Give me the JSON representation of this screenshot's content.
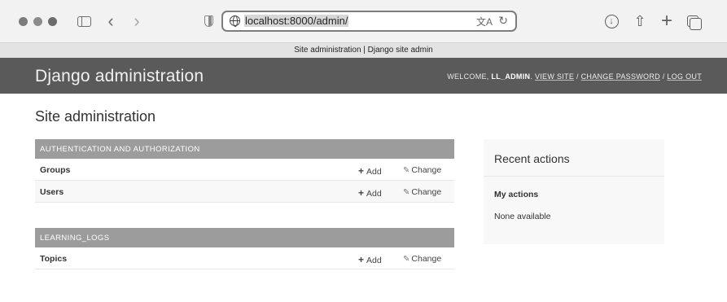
{
  "browser": {
    "url_prefix": "",
    "url": "localhost:8000/admin/",
    "tab_title": "Site administration | Django site admin",
    "back_glyph": "‹",
    "forward_glyph": "›",
    "translate_glyph": "文A",
    "reload_glyph": "↻",
    "download_glyph": "↓",
    "share_glyph": "⇧",
    "new_tab_glyph": "+"
  },
  "header": {
    "branding": "Django administration",
    "welcome": "WELCOME,",
    "username": "LL_ADMIN",
    "view_site": "VIEW SITE",
    "change_password": "CHANGE PASSWORD",
    "log_out": "LOG OUT",
    "separator": "/"
  },
  "content": {
    "title": "Site administration",
    "modules": [
      {
        "caption": "AUTHENTICATION AND AUTHORIZATION",
        "rows": [
          {
            "name": "Groups",
            "add": "Add",
            "change": "Change"
          },
          {
            "name": "Users",
            "add": "Add",
            "change": "Change"
          }
        ]
      },
      {
        "caption": "LEARNING_LOGS",
        "rows": [
          {
            "name": "Topics",
            "add": "Add",
            "change": "Change"
          }
        ]
      }
    ]
  },
  "recent_actions": {
    "title": "Recent actions",
    "subtitle": "My actions",
    "empty": "None available"
  },
  "icons": {
    "add": "+",
    "change": "✎"
  }
}
